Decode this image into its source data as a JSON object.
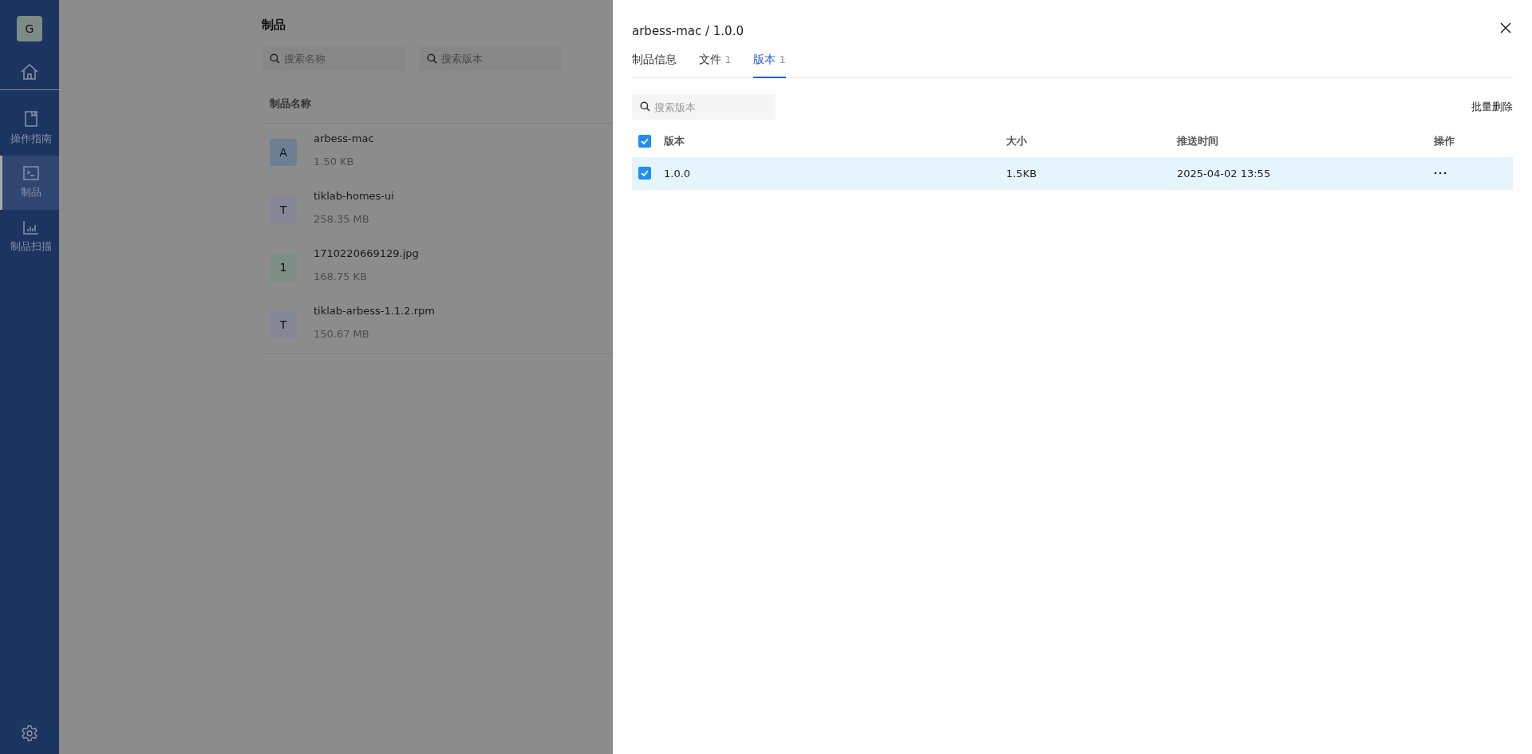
{
  "sidebar": {
    "avatar": "G",
    "items": [
      {
        "label": "操作指南",
        "selected": false
      },
      {
        "label": "制品",
        "selected": true
      },
      {
        "label": "制品扫描",
        "selected": false
      }
    ]
  },
  "main": {
    "title": "制品",
    "search_fields": [
      {
        "placeholder": "搜索名称"
      },
      {
        "placeholder": "搜索版本"
      }
    ],
    "column": "制品名称",
    "items": [
      {
        "initial": "A",
        "name": "arbess-mac",
        "size": "1.50 KB",
        "color": "#6e7f93"
      },
      {
        "initial": "T",
        "name": "tiklab-homes-ui",
        "size": "258.35 MB",
        "color": "#858797"
      },
      {
        "initial": "1",
        "name": "1710220669129.jpg",
        "size": "168.75 KB",
        "color": "#7b8d85"
      },
      {
        "initial": "T",
        "name": "tiklab-arbess-1.1.2.rpm",
        "size": "150.67 MB",
        "color": "#858797"
      }
    ]
  },
  "drawer": {
    "title": "arbess-mac / 1.0.0",
    "tabs": [
      {
        "label": "制品信息",
        "selected": false
      },
      {
        "label": "文件",
        "count": "1",
        "selected": false
      },
      {
        "label": "版本",
        "count": "1",
        "selected": true
      }
    ],
    "search": {
      "placeholder": "搜索版本"
    },
    "batch_delete": "批量删除",
    "table": {
      "all_checked": true,
      "columns": [
        "版本",
        "大小",
        "推送时间",
        "操作"
      ],
      "rows": [
        {
          "version": "1.0.0",
          "size": "1.5KB",
          "pushed": "2025-04-02 13:55",
          "checked": true,
          "selected": true
        }
      ]
    }
  }
}
